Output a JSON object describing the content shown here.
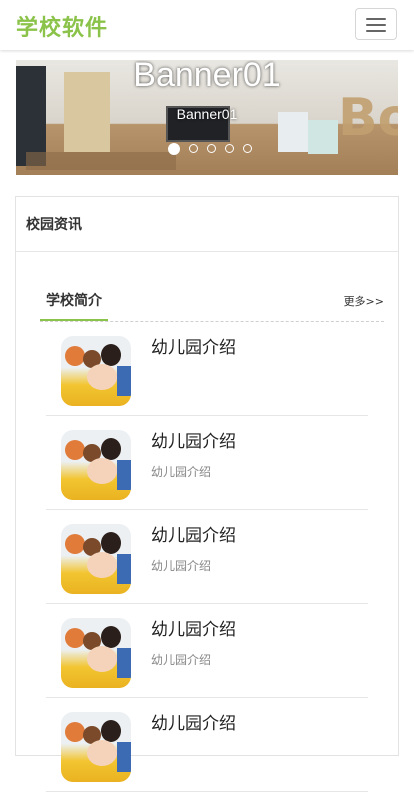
{
  "navbar": {
    "brand": "学校软件",
    "menu_icon": "hamburger-menu-icon"
  },
  "banner": {
    "title": "Banner01",
    "caption": "Banner01",
    "slide_count": 5,
    "active_slide": 1
  },
  "panel": {
    "title": "校园资讯",
    "section": {
      "tab_label": "学校简介",
      "more_label": "更多>>"
    },
    "items": [
      {
        "title": "幼儿园介绍",
        "desc": ""
      },
      {
        "title": "幼儿园介绍",
        "desc": "幼儿园介绍"
      },
      {
        "title": "幼儿园介绍",
        "desc": "幼儿园介绍"
      },
      {
        "title": "幼儿园介绍",
        "desc": "幼儿园介绍"
      },
      {
        "title": "幼儿园介绍",
        "desc": ""
      }
    ]
  },
  "colors": {
    "accent": "#8bc34a",
    "text": "#333333",
    "muted": "#888888"
  }
}
